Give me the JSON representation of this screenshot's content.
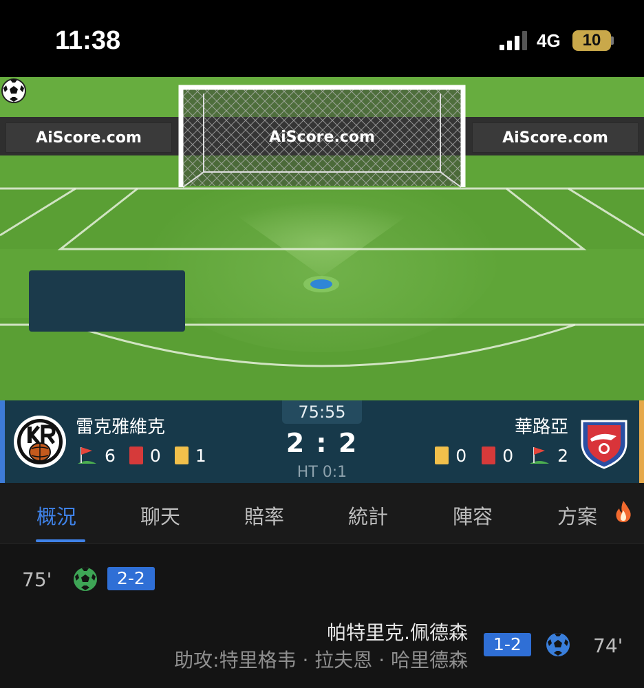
{
  "status_bar": {
    "time": "11:38",
    "network": "4G",
    "battery": "10"
  },
  "pitch": {
    "ads": [
      "AiScore.com",
      "AiScore.com",
      "AiScore.com"
    ]
  },
  "match": {
    "clock": "75:55",
    "score": "2 : 2",
    "halftime": "HT 0:1",
    "home": {
      "name": "雷克雅維克",
      "corners": "6",
      "red_cards": "0",
      "yellow_cards": "1",
      "color": "#3d7bd8"
    },
    "away": {
      "name": "華路亞",
      "yellow_cards": "0",
      "red_cards": "0",
      "corners": "2",
      "color": "#e6a94a"
    }
  },
  "tabs": [
    {
      "label": "概況",
      "active": true
    },
    {
      "label": "聊天"
    },
    {
      "label": "賠率"
    },
    {
      "label": "統計"
    },
    {
      "label": "陣容"
    },
    {
      "label": "方案",
      "icon": "fire-icon"
    }
  ],
  "events": [
    {
      "minute": "75'",
      "side": "home",
      "icon": "soccer-ball-icon",
      "score": "2-2"
    },
    {
      "minute": "74'",
      "side": "away",
      "icon": "soccer-ball-icon",
      "score": "1-2",
      "player": "帕特里克.佩德森",
      "assist": "助攻:特里格韦 · 拉夫恩 · 哈里德森"
    }
  ],
  "colors": {
    "accent": "#3f82e8",
    "score_bar": "#17394a",
    "badge": "#2f6fd6"
  }
}
